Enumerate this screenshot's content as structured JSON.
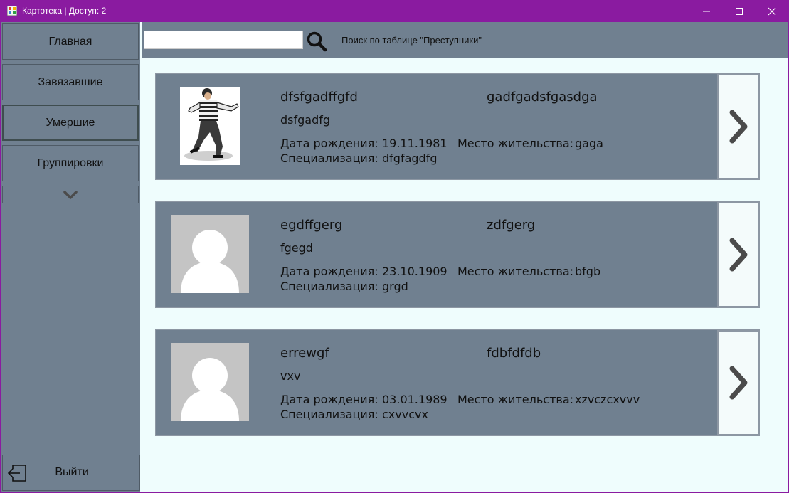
{
  "window": {
    "title": "Картотека | Доступ: 2",
    "buttons": [
      "minimize-icon",
      "maximize-icon",
      "close-icon"
    ],
    "colors": {
      "titlebar": "#8a1ba0",
      "panel": "#708090",
      "content": "#effdfd"
    }
  },
  "sidebar": {
    "items": [
      {
        "label": "Главная"
      },
      {
        "label": "Завязавшие"
      },
      {
        "label": "Умершие",
        "active": true
      },
      {
        "label": "Группировки"
      }
    ],
    "more_icon": "chevron-down-icon",
    "exit_label": "Выйти",
    "exit_icon": "exit-door-icon"
  },
  "search": {
    "value": "",
    "icon": "search-icon",
    "label": "Поиск по таблице \"Преступники\""
  },
  "fields": {
    "birth_label": "Дата рождения:",
    "residence_label": "Место жительства:",
    "spec_label": "Специализация:"
  },
  "records": [
    {
      "surname": "dfsfgadffgfd",
      "name": "gadfgadsfgasdga",
      "patronymic": "dsfgadfg",
      "birth_date": "19.11.1981",
      "residence": "gaga",
      "specialization": "dfgfagdfg",
      "photo": "burglar-photo"
    },
    {
      "surname": "egdffgerg",
      "name": "zdfgerg",
      "patronymic": "fgegd",
      "birth_date": "23.10.1909",
      "residence": "bfgb",
      "specialization": "grgd",
      "photo": "avatar-placeholder-icon"
    },
    {
      "surname": "errewgf",
      "name": "fdbfdfdb",
      "patronymic": "vxv",
      "birth_date": "03.01.1989",
      "residence": "xzvczcxvvv",
      "specialization": "cxvvcvx",
      "photo": "avatar-placeholder-icon"
    }
  ]
}
